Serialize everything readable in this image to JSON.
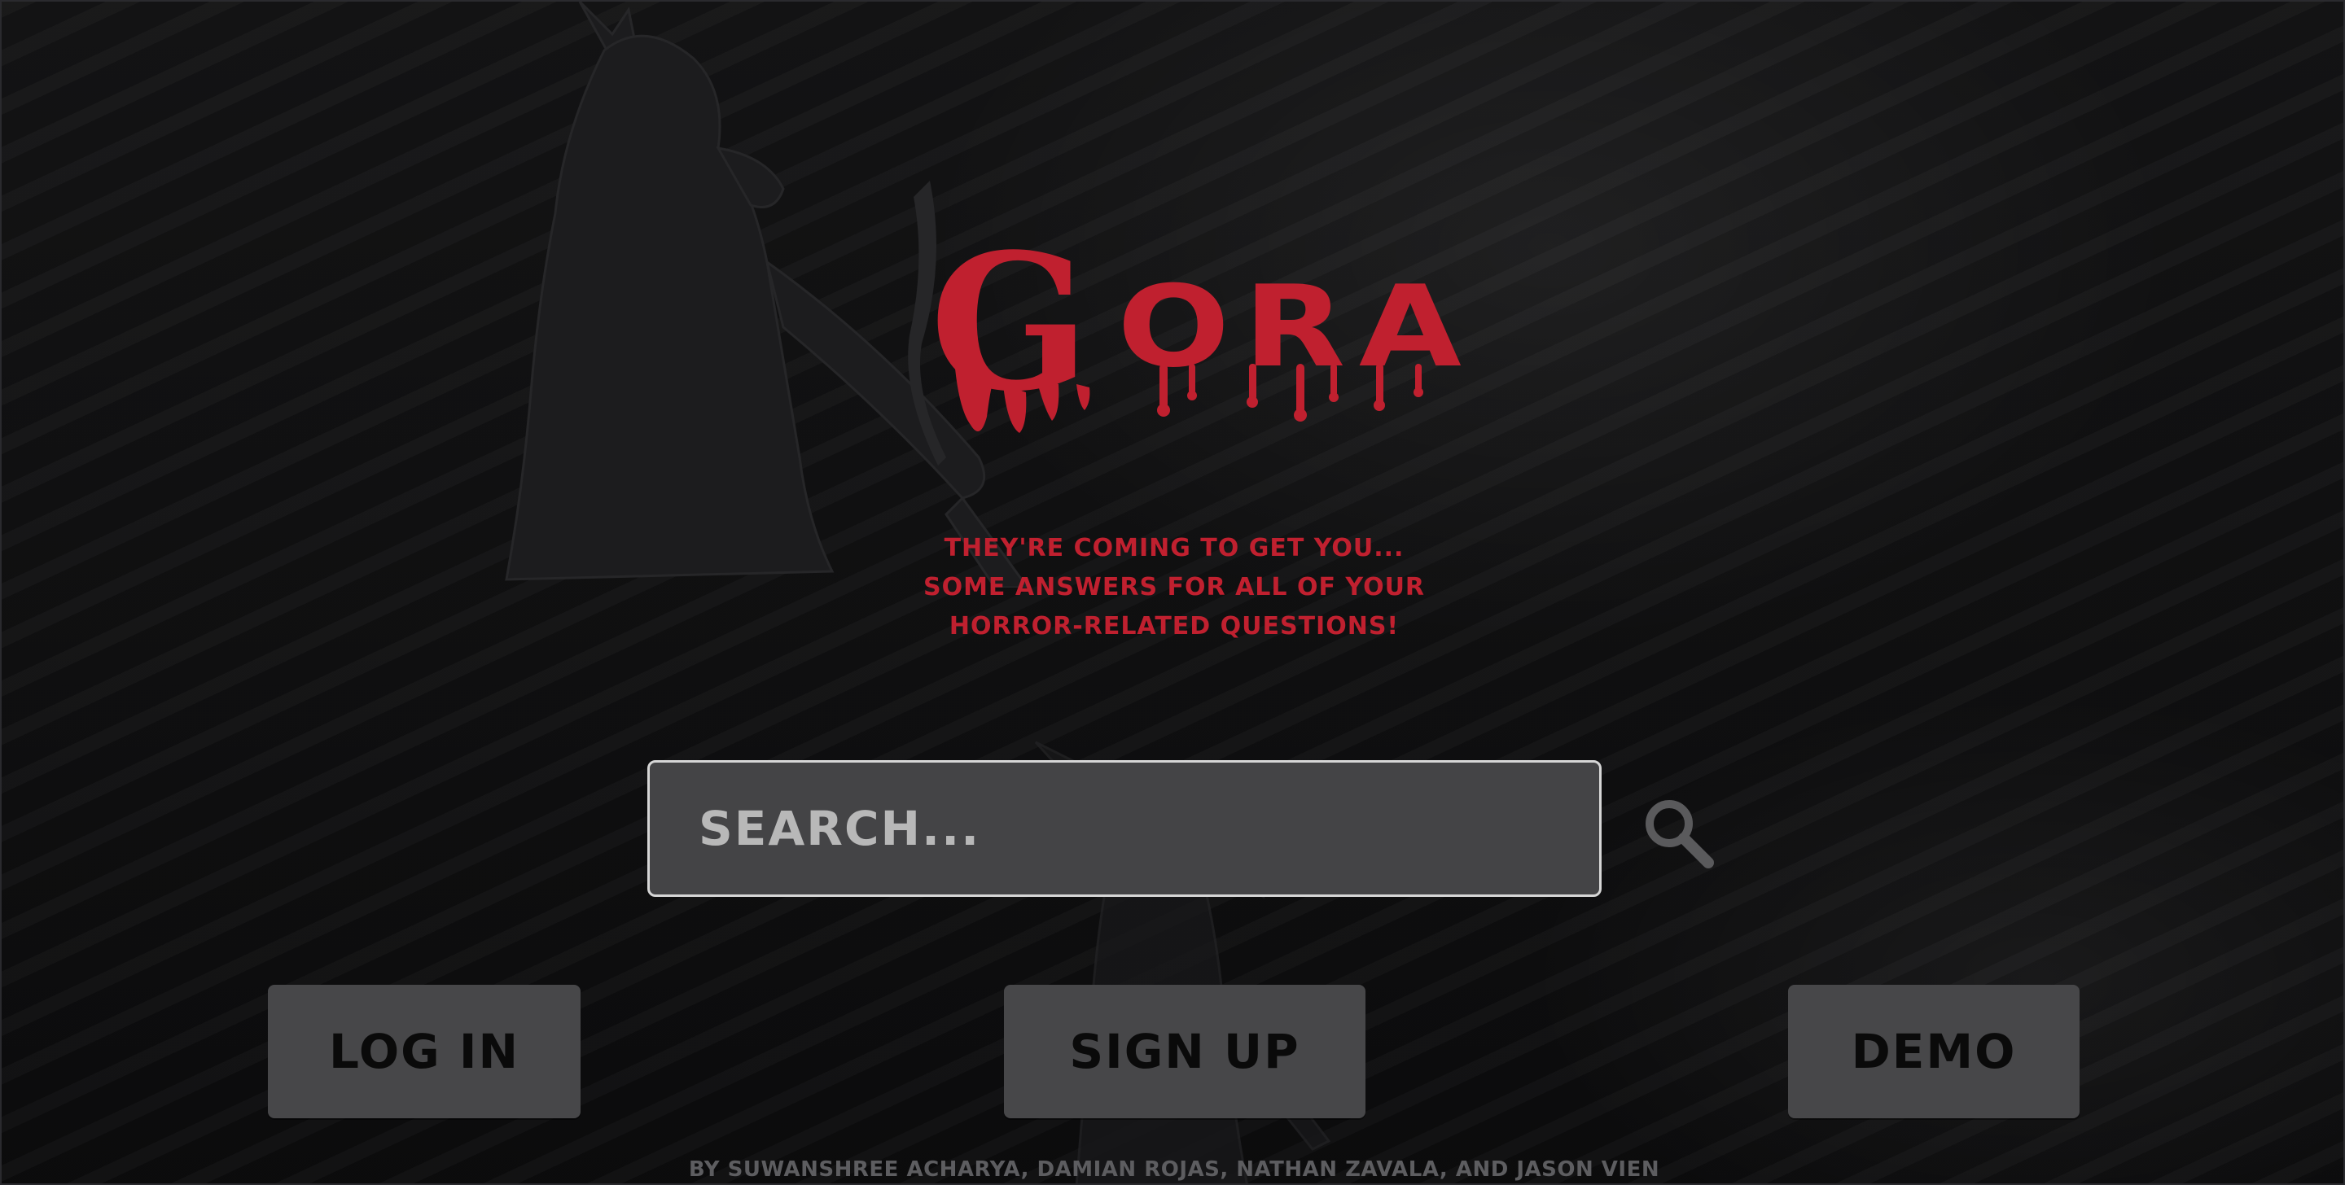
{
  "logo": {
    "first_letter": "G",
    "rest": "ORA"
  },
  "tagline": {
    "lines": [
      "THEY'RE COMING TO GET YOU...",
      "SOME ANSWERS FOR ALL OF YOUR",
      "HORROR-RELATED QUESTIONS!"
    ]
  },
  "search": {
    "placeholder": "SEARCH...",
    "value": "",
    "icon": "magnifier-icon"
  },
  "buttons": {
    "login": "LOG IN",
    "signup": "SIGN UP",
    "demo": "DEMO"
  },
  "footer": {
    "credits": "BY SUWANSHREE ACHARYA, DAMIAN ROJAS, NATHAN ZAVALA, AND JASON VIEN"
  },
  "colors": {
    "accent_red": "#c0202f",
    "button_bg": "#474749",
    "search_bg": "#444446",
    "background": "#111112"
  }
}
